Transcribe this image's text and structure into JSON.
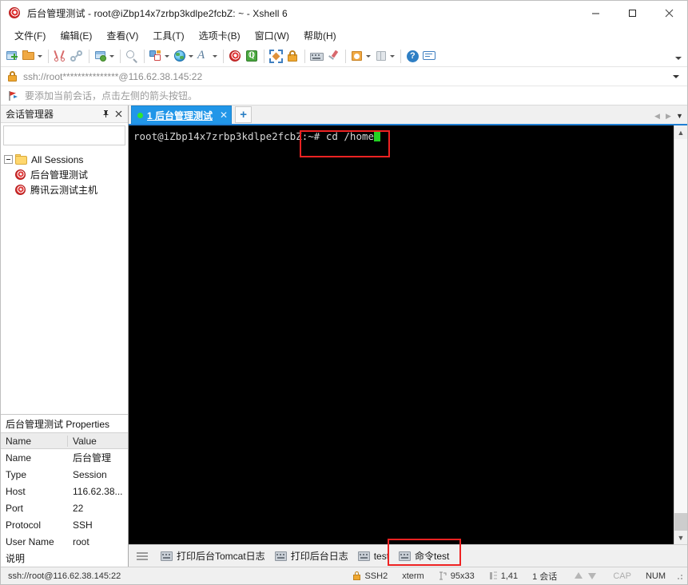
{
  "window": {
    "title": "后台管理测试 - root@iZbp14x7zrbp3kdlpe2fcbZ: ~ - Xshell 6",
    "app_icon": "xshell-spiral-icon",
    "minimize": "—",
    "maximize": "☐",
    "close": "✕"
  },
  "menubar": {
    "items": [
      {
        "label": "文件(F)",
        "name": "menu-file"
      },
      {
        "label": "编辑(E)",
        "name": "menu-edit"
      },
      {
        "label": "查看(V)",
        "name": "menu-view"
      },
      {
        "label": "工具(T)",
        "name": "menu-tools"
      },
      {
        "label": "选项卡(B)",
        "name": "menu-tab"
      },
      {
        "label": "窗口(W)",
        "name": "menu-window"
      },
      {
        "label": "帮助(H)",
        "name": "menu-help"
      }
    ]
  },
  "toolbar": {
    "items": [
      {
        "name": "new-session-icon"
      },
      {
        "name": "open-session-icon",
        "caret": true
      },
      {
        "name": "cut-icon"
      },
      {
        "name": "link-icon"
      },
      {
        "name": "session-properties-icon",
        "caret": true
      },
      {
        "name": "find-icon"
      },
      {
        "name": "file-transfer-icon",
        "caret": true
      },
      {
        "name": "globe-icon",
        "caret": true
      },
      {
        "name": "font-icon",
        "caret": true
      },
      {
        "name": "xshell-icon"
      },
      {
        "name": "xftp-icon"
      },
      {
        "name": "fullscreen-icon"
      },
      {
        "name": "lock-icon"
      },
      {
        "name": "keyboard-icon"
      },
      {
        "name": "highlight-icon"
      },
      {
        "name": "record-icon",
        "caret": true
      },
      {
        "name": "layout-icon",
        "caret": true
      },
      {
        "name": "help-icon"
      },
      {
        "name": "feedback-icon"
      }
    ]
  },
  "addressbar": {
    "lock_icon": "lock-icon",
    "url": "ssh://root***************@116.62.38.145:22",
    "dropdown_icon": "chevron-down-icon"
  },
  "noticebar": {
    "flag_icon": "red-flag-icon",
    "text": "要添加当前会话，点击左侧的箭头按钮。"
  },
  "session_manager": {
    "title": "会话管理器",
    "pin_icon": "pin-icon",
    "close_icon": "close-icon",
    "search": {
      "value": "",
      "placeholder": ""
    },
    "search_icon": "search-icon",
    "tree": {
      "root": {
        "label": "All Sessions",
        "icon": "folder-icon",
        "expander": "collapse-icon"
      },
      "children": [
        {
          "label": "后台管理测试",
          "icon": "session-icon"
        },
        {
          "label": "腾讯云测试主机",
          "icon": "session-icon"
        }
      ]
    }
  },
  "properties": {
    "title": "后台管理测试 Properties",
    "columns": [
      "Name",
      "Value"
    ],
    "rows": [
      {
        "name": "Name",
        "value": "后台管理"
      },
      {
        "name": "Type",
        "value": "Session"
      },
      {
        "name": "Host",
        "value": "116.62.38..."
      },
      {
        "name": "Port",
        "value": "22"
      },
      {
        "name": "Protocol",
        "value": "SSH"
      },
      {
        "name": "User Name",
        "value": "root"
      },
      {
        "name": "说明",
        "value": ""
      }
    ]
  },
  "tabs": {
    "items": [
      {
        "label": "1 后台管理测试",
        "status_icon": "connected-dot-icon",
        "close_icon": "close-icon",
        "active": true
      }
    ],
    "add_label": "+",
    "nav_prev_icon": "chevron-left-icon",
    "nav_next_icon": "chevron-right-icon",
    "nav_list_icon": "tab-list-icon"
  },
  "terminal": {
    "prompt": "root@iZbp14x7zrbp3kdlpe2fcbZ:~# ",
    "command": "cd /home",
    "cursor": "block-cursor",
    "colors": {
      "background": "#000000",
      "foreground": "#d8d8d8",
      "cursor": "#22d122"
    }
  },
  "quickbar": {
    "menu_icon": "hamburger-icon",
    "buttons": [
      {
        "label": "打印后台Tomcat日志",
        "icon": "keyboard-icon"
      },
      {
        "label": "打印后台日志",
        "icon": "keyboard-icon"
      },
      {
        "label": "test",
        "icon": "keyboard-icon"
      },
      {
        "label": "命令test",
        "icon": "keyboard-icon"
      }
    ]
  },
  "statusbar": {
    "connection": "ssh://root@116.62.38.145:22",
    "lock_icon": "lock-icon",
    "protocol": "SSH2",
    "term_type": "xterm",
    "size_icon": "size-icon",
    "size": "95x33",
    "cursor_icon": "cursor-pos-icon",
    "cursor_pos": "1,41",
    "sessions": "1 会话",
    "upload_icon": "arrow-up-icon",
    "download_icon": "arrow-down-icon",
    "caps": "CAP",
    "num": "NUM",
    "grip_icon": "resize-grip-icon"
  },
  "annotations": {
    "accent_red": "#ee2222",
    "boxes": [
      {
        "name": "command-highlight-box"
      },
      {
        "name": "quick-command-highlight-box"
      }
    ]
  }
}
